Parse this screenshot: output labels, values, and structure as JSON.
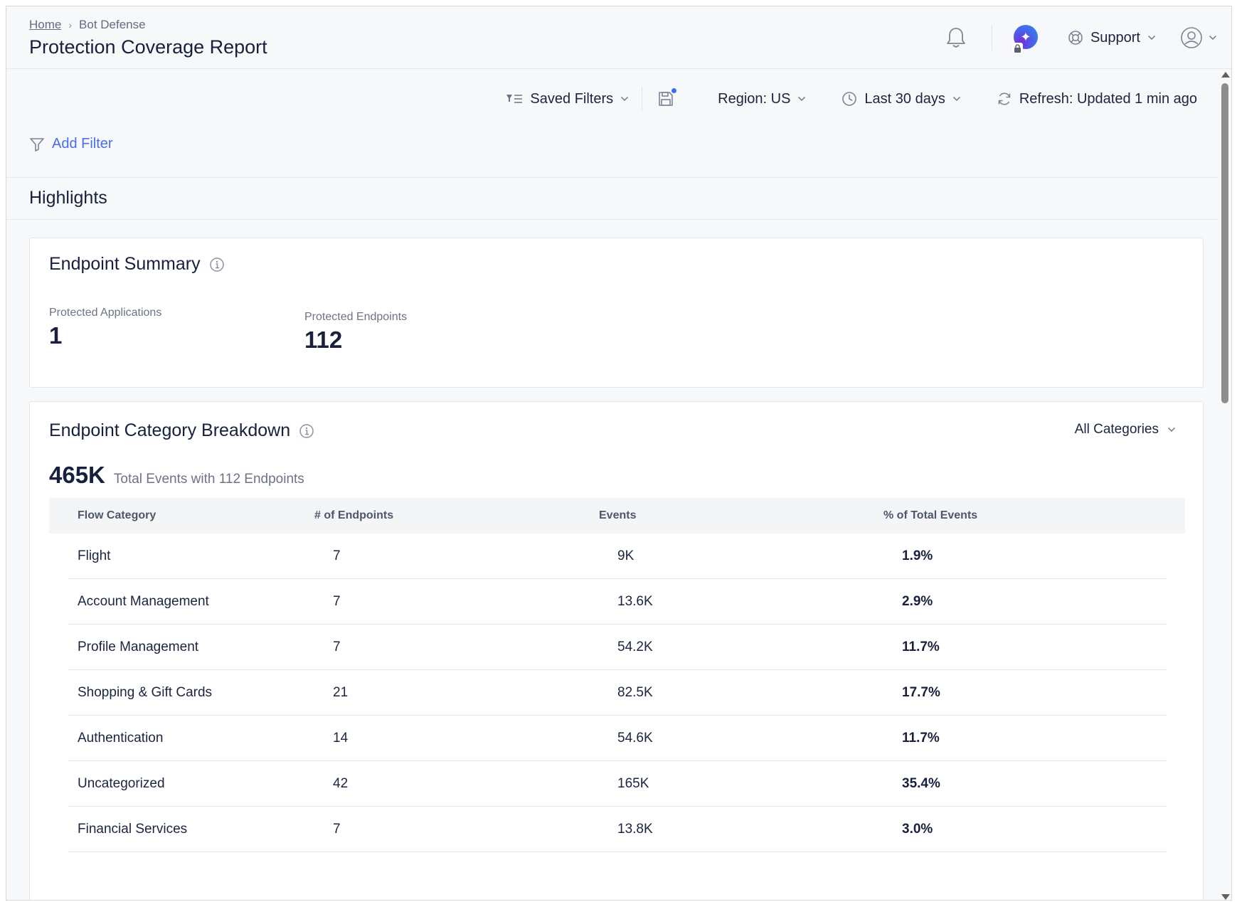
{
  "header": {
    "breadcrumb": {
      "home": "Home",
      "current": "Bot Defense",
      "separator": "›"
    },
    "title": "Protection Coverage Report",
    "support_label": "Support"
  },
  "toolbar": {
    "saved_filters": "Saved Filters",
    "region": "Region: US",
    "time_range": "Last 30 days",
    "refresh": "Refresh: Updated 1 min ago"
  },
  "add_filter": "Add Filter",
  "highlights_title": "Highlights",
  "endpoint_summary": {
    "title": "Endpoint Summary",
    "protected_applications_label": "Protected Applications",
    "protected_applications_value": "1",
    "protected_endpoints_label": "Protected Endpoints",
    "protected_endpoints_value": "112"
  },
  "category_breakdown": {
    "title": "Endpoint Category Breakdown",
    "category_select": "All Categories",
    "total_value": "465K",
    "total_text": "Total Events with 112 Endpoints",
    "columns": [
      "Flow Category",
      "# of Endpoints",
      "Events",
      "% of Total Events"
    ],
    "rows": [
      {
        "category": "Flight",
        "endpoints": "7",
        "events": "9K",
        "percent": "1.9%"
      },
      {
        "category": "Account Management",
        "endpoints": "7",
        "events": "13.6K",
        "percent": "2.9%"
      },
      {
        "category": "Profile Management",
        "endpoints": "7",
        "events": "54.2K",
        "percent": "11.7%"
      },
      {
        "category": "Shopping & Gift Cards",
        "endpoints": "21",
        "events": "82.5K",
        "percent": "17.7%"
      },
      {
        "category": "Authentication",
        "endpoints": "14",
        "events": "54.6K",
        "percent": "11.7%"
      },
      {
        "category": "Uncategorized",
        "endpoints": "42",
        "events": "165K",
        "percent": "35.4%"
      },
      {
        "category": "Financial Services",
        "endpoints": "7",
        "events": "13.8K",
        "percent": "3.0%"
      }
    ]
  },
  "colors": {
    "accent": "#4a6cf0",
    "text_dark": "#17203c",
    "muted": "#6b7385",
    "notification_dot": "#3b6ef5"
  },
  "icons": [
    "bell-icon",
    "ai-assistant-icon",
    "lock-icon",
    "lifebuoy-icon",
    "user-avatar-icon",
    "chevron-down-icon",
    "filter-list-icon",
    "save-icon",
    "clock-icon",
    "refresh-icon",
    "funnel-icon",
    "info-icon"
  ]
}
